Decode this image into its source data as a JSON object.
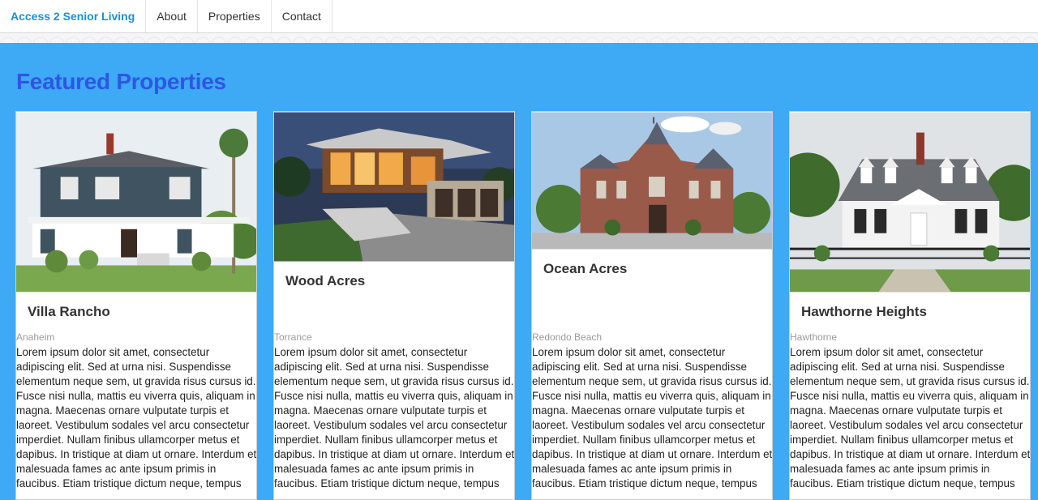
{
  "nav": {
    "brand": "Access 2 Senior Living",
    "items": [
      {
        "label": "About"
      },
      {
        "label": "Properties"
      },
      {
        "label": "Contact"
      }
    ]
  },
  "page": {
    "title": "Featured Properties"
  },
  "properties": [
    {
      "name": "Villa Rancho",
      "city": "Anaheim",
      "description": "Lorem ipsum dolor sit amet, consectetur adipiscing elit. Sed at urna nisi. Suspendisse elementum neque sem, ut gravida risus cursus id. Fusce nisi nulla, mattis eu viverra quis, aliquam in magna. Maecenas ornare vulputate turpis et laoreet. Vestibulum sodales vel arcu consectetur imperdiet. Nullam finibus ullamcorper metus et dapibus. In tristique at diam ut ornare. Interdum et malesuada fames ac ante ipsum primis in faucibus. Etiam tristique dictum neque, tempus"
    },
    {
      "name": "Wood Acres",
      "city": "Torrance",
      "description": "Lorem ipsum dolor sit amet, consectetur adipiscing elit. Sed at urna nisi. Suspendisse elementum neque sem, ut gravida risus cursus id. Fusce nisi nulla, mattis eu viverra quis, aliquam in magna. Maecenas ornare vulputate turpis et laoreet. Vestibulum sodales vel arcu consectetur imperdiet. Nullam finibus ullamcorper metus et dapibus. In tristique at diam ut ornare. Interdum et malesuada fames ac ante ipsum primis in faucibus. Etiam tristique dictum neque, tempus"
    },
    {
      "name": "Ocean Acres",
      "city": "Redondo Beach",
      "description": "Lorem ipsum dolor sit amet, consectetur adipiscing elit. Sed at urna nisi. Suspendisse elementum neque sem, ut gravida risus cursus id. Fusce nisi nulla, mattis eu viverra quis, aliquam in magna. Maecenas ornare vulputate turpis et laoreet. Vestibulum sodales vel arcu consectetur imperdiet. Nullam finibus ullamcorper metus et dapibus. In tristique at diam ut ornare. Interdum et malesuada fames ac ante ipsum primis in faucibus. Etiam tristique dictum neque, tempus"
    },
    {
      "name": "Hawthorne Heights",
      "city": "Hawthorne",
      "description": "Lorem ipsum dolor sit amet, consectetur adipiscing elit. Sed at urna nisi. Suspendisse elementum neque sem, ut gravida risus cursus id. Fusce nisi nulla, mattis eu viverra quis, aliquam in magna. Maecenas ornare vulputate turpis et laoreet. Vestibulum sodales vel arcu consectetur imperdiet. Nullam finibus ullamcorper metus et dapibus. In tristique at diam ut ornare. Interdum et malesuada fames ac ante ipsum primis in faucibus. Etiam tristique dictum neque, tempus"
    }
  ],
  "colors": {
    "page_background": "#3ea9f5",
    "brand": "#1c8fd6",
    "title": "#2f55e6"
  }
}
